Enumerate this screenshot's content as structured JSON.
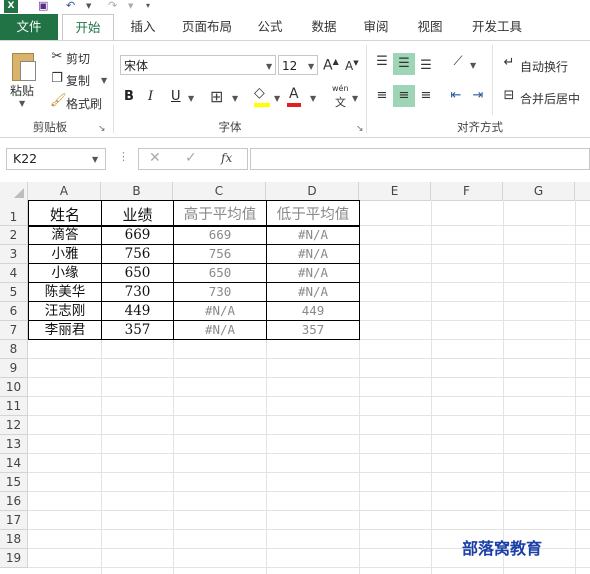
{
  "quick_access": {
    "excel_icon": "excel-logo-icon",
    "save_icon": "save-icon",
    "undo_icon": "undo-icon",
    "redo_icon": "redo-icon",
    "customize_icon": "customize-toolbar-icon"
  },
  "tabs": [
    {
      "label": "文件"
    },
    {
      "label": "开始"
    },
    {
      "label": "插入"
    },
    {
      "label": "页面布局"
    },
    {
      "label": "公式"
    },
    {
      "label": "数据"
    },
    {
      "label": "审阅"
    },
    {
      "label": "视图"
    },
    {
      "label": "开发工具"
    }
  ],
  "clipboard": {
    "group_label": "剪贴板",
    "paste_label": "粘贴",
    "cut_label": "剪切",
    "copy_label": "复制",
    "format_painter_label": "格式刷"
  },
  "font": {
    "group_label": "字体",
    "font_name": "宋体",
    "font_size": "12",
    "bold": "B",
    "italic": "I",
    "underline": "U",
    "grow": "A",
    "shrink": "A",
    "wen": "wén",
    "wen_char": "文"
  },
  "alignment": {
    "group_label": "对齐方式",
    "wrap_label": "自动换行",
    "merge_label": "合并后居中"
  },
  "formula_bar": {
    "name_box": "K22",
    "fx": "fx",
    "formula": ""
  },
  "columns": [
    "A",
    "B",
    "C",
    "D",
    "E",
    "F",
    "G"
  ],
  "rows": [
    "1",
    "2",
    "3",
    "4",
    "5",
    "6",
    "7",
    "8",
    "9",
    "10",
    "11",
    "12",
    "13",
    "14",
    "15",
    "16",
    "17",
    "18",
    "19"
  ],
  "table": {
    "headers": [
      "姓名",
      "业绩",
      "高于平均值",
      "低于平均值"
    ],
    "rows": [
      [
        "滴答",
        "669",
        "669",
        "#N/A"
      ],
      [
        "小雅",
        "756",
        "756",
        "#N/A"
      ],
      [
        "小缘",
        "650",
        "650",
        "#N/A"
      ],
      [
        "陈美华",
        "730",
        "730",
        "#N/A"
      ],
      [
        "汪志刚",
        "449",
        "#N/A",
        "449"
      ],
      [
        "李丽君",
        "357",
        "#N/A",
        "357"
      ]
    ]
  },
  "watermark": "部落窝教育",
  "colors": {
    "file_tab": "#217346",
    "accent": "#217346",
    "selected_align": "#9fd5b7",
    "watermark": "#1a3fa6"
  }
}
